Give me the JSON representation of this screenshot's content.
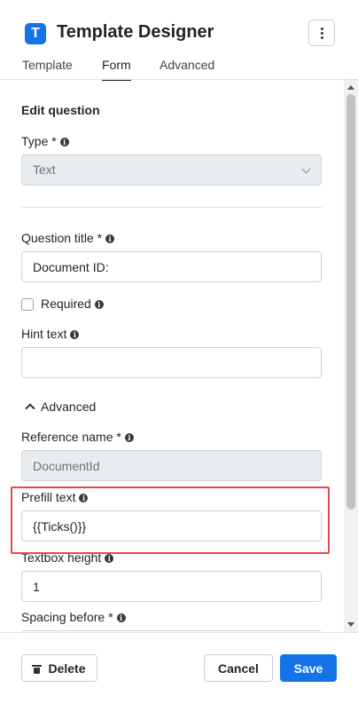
{
  "app": {
    "logo_letter": "T",
    "title": "Template Designer"
  },
  "tabs": [
    {
      "label": "Template",
      "active": false
    },
    {
      "label": "Form",
      "active": true
    },
    {
      "label": "Advanced",
      "active": false
    }
  ],
  "form": {
    "section_title": "Edit question",
    "type": {
      "label": "Type *",
      "value": "Text"
    },
    "question_title": {
      "label": "Question title *",
      "value": "Document ID:"
    },
    "required": {
      "label": "Required",
      "checked": false
    },
    "hint_text": {
      "label": "Hint text",
      "value": ""
    },
    "advanced_toggle": "Advanced",
    "reference_name": {
      "label": "Reference name *",
      "value": "DocumentId"
    },
    "prefill_text": {
      "label": "Prefill text",
      "value": "{{Ticks()}}"
    },
    "textbox_height": {
      "label": "Textbox height",
      "value": "1"
    },
    "spacing_before": {
      "label": "Spacing before *"
    }
  },
  "footer": {
    "delete_label": "Delete",
    "cancel_label": "Cancel",
    "save_label": "Save"
  },
  "colors": {
    "accent": "#1473e6",
    "highlight": "#e5494d"
  },
  "icons": [
    "logo-icon",
    "more-options-icon",
    "info-icon",
    "chevron-down-icon",
    "chevron-up-icon",
    "trash-icon"
  ]
}
